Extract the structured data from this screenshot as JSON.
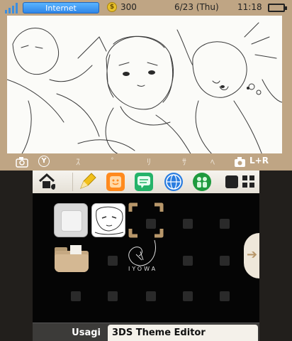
{
  "status": {
    "network": "Internet",
    "coin_count": "300",
    "coin_symbol": "$",
    "date": "6/23 (Thu)",
    "time": "11:18"
  },
  "camera_strip": {
    "y_button": "Y",
    "shortcut": "L+R"
  },
  "toolbar": {
    "icons": [
      "home-settings-icon",
      "pencil-icon",
      "smile-icon",
      "chat-icon",
      "globe-icon",
      "people-icon",
      "single-view-icon",
      "grid-view-icon"
    ]
  },
  "tiles": {
    "signature": "IYOWA"
  },
  "footer": {
    "user_name": "Usagi",
    "app_title": "3DS Theme Editor"
  },
  "colors": {
    "frame": "#bfa584",
    "grid_bg": "#050505",
    "network": "#2f86e8"
  }
}
